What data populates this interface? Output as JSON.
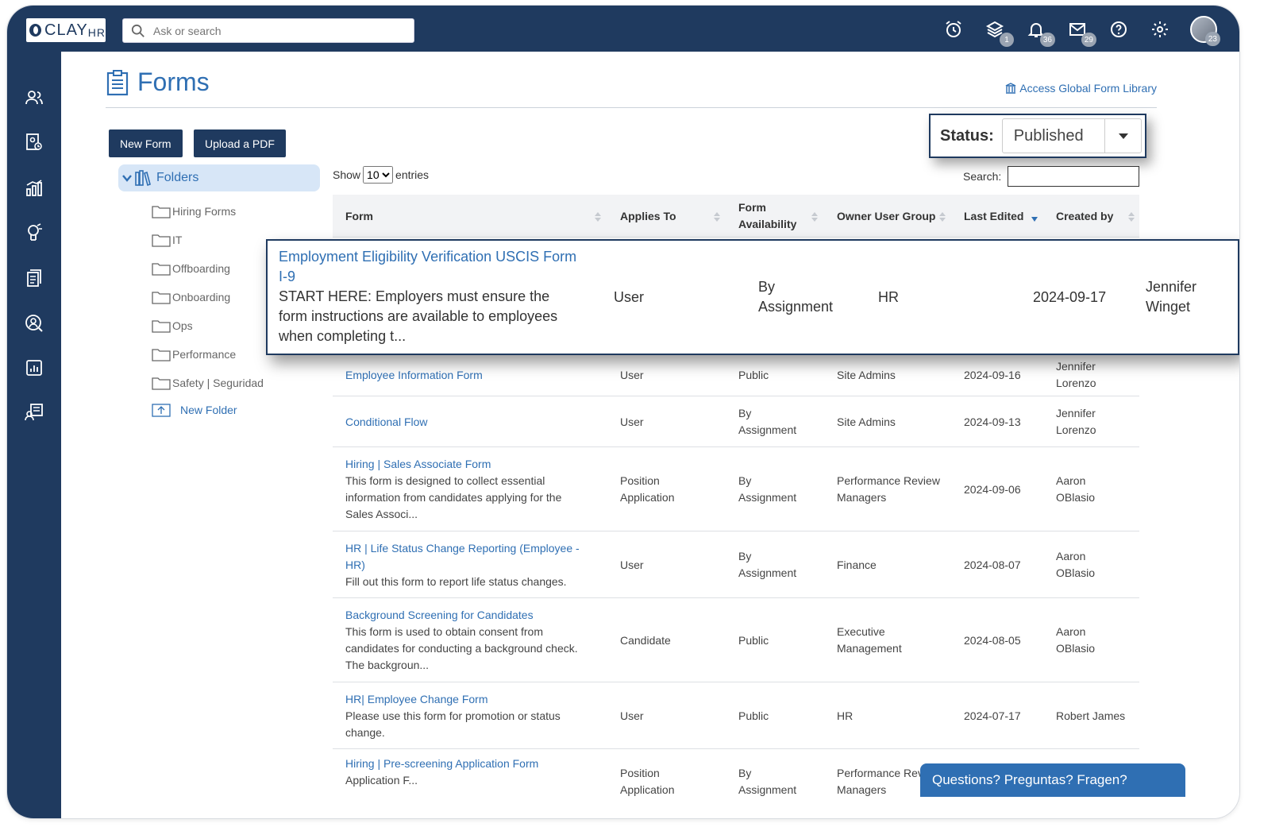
{
  "topbar": {
    "logo_clay": "CLAY",
    "logo_hr": "HR",
    "search_placeholder": "Ask or search",
    "icons": [
      {
        "name": "alarm-clock-icon",
        "badge": ""
      },
      {
        "name": "layers-icon",
        "badge": "1"
      },
      {
        "name": "bell-icon",
        "badge": "36"
      },
      {
        "name": "mail-icon",
        "badge": "29"
      },
      {
        "name": "help-icon",
        "badge": ""
      },
      {
        "name": "gear-icon",
        "badge": ""
      }
    ],
    "avatar_badge": "23"
  },
  "sidebar": {
    "icons": [
      "people-icon",
      "employee-record-icon",
      "analytics-icon",
      "learning-icon",
      "forms-icon",
      "recruiting-icon",
      "reports-icon",
      "onboarding-icon"
    ]
  },
  "page": {
    "title": "Forms",
    "global_link": "Access Global Form Library",
    "buttons": {
      "new_form": "New Form",
      "upload_pdf": "Upload a PDF"
    },
    "status": {
      "label": "Status:",
      "value": "Published"
    }
  },
  "folders": {
    "title": "Folders",
    "items": [
      "Hiring Forms",
      "IT",
      "Offboarding",
      "Onboarding",
      "Ops",
      "Performance",
      "Safety | Seguridad"
    ],
    "new_folder": "New Folder"
  },
  "table_controls": {
    "show": "Show",
    "entries_value": "10",
    "entries": "entries",
    "search_label": "Search:"
  },
  "table": {
    "columns": [
      "Form",
      "Applies To",
      "Form Availability",
      "Owner User Group",
      "Last Edited",
      "Created by"
    ],
    "highlight_row": {
      "title": "Employment Eligibility Verification USCIS Form I-9",
      "desc": "START HERE: Employers must ensure the form instructions are available to employees when completing t...",
      "applies_to": "User",
      "availability": "By Assignment",
      "owner": "HR",
      "last_edited": "2024-09-17",
      "created_by": "Jennifer Winget"
    },
    "rows": [
      {
        "title": "Employee Information Form",
        "desc": "",
        "applies_to": "User",
        "availability": "Public",
        "owner": "Site Admins",
        "last_edited": "2024-09-16",
        "created_by": "Jennifer Lorenzo"
      },
      {
        "title": "Conditional Flow",
        "desc": "",
        "applies_to": "User",
        "availability": "By Assignment",
        "owner": "Site Admins",
        "last_edited": "2024-09-13",
        "created_by": "Jennifer Lorenzo"
      },
      {
        "title": "Hiring | Sales Associate Form",
        "desc": "This form is designed to collect essential information from candidates applying for the Sales Associ...",
        "applies_to": "Position Application",
        "availability": "By Assignment",
        "owner": "Performance Review Managers",
        "last_edited": "2024-09-06",
        "created_by": "Aaron OBlasio"
      },
      {
        "title": "HR | Life Status Change Reporting (Employee - HR)",
        "desc": "Fill out this form to report life status changes.",
        "applies_to": "User",
        "availability": "By Assignment",
        "owner": "Finance",
        "last_edited": "2024-08-07",
        "created_by": "Aaron OBlasio"
      },
      {
        "title": "Background Screening for Candidates",
        "desc": "This form is used to obtain consent from candidates for conducting a background check. The backgroun...",
        "applies_to": "Candidate",
        "availability": "Public",
        "owner": "Executive Management",
        "last_edited": "2024-08-05",
        "created_by": "Aaron OBlasio"
      },
      {
        "title": "HR| Employee Change Form",
        "desc": "Please use this form for promotion or status change.",
        "applies_to": "User",
        "availability": "Public",
        "owner": "HR",
        "last_edited": "2024-07-17",
        "created_by": "Robert James"
      },
      {
        "title": "Hiring | Pre-screening Application Form",
        "desc": "Application F...",
        "applies_to": "Position Application",
        "availability": "By Assignment",
        "owner": "Performance Review Managers",
        "last_edited": "",
        "created_by": ""
      }
    ]
  },
  "chat": {
    "label": "Questions? Preguntas? Fragen?"
  },
  "colors": {
    "navy": "#1f3a5f",
    "link": "#2f6fb3",
    "folder_highlight": "#d7e6f7"
  }
}
